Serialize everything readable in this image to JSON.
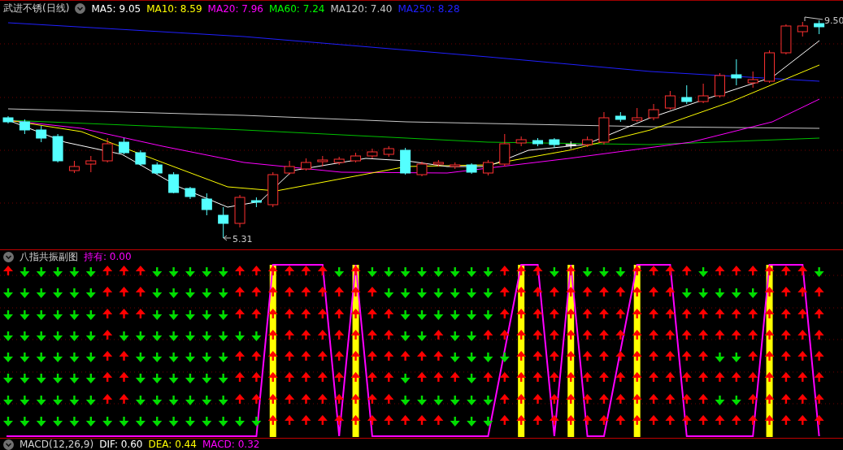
{
  "main_panel": {
    "title": "武进不锈(日线)",
    "indicators": [
      {
        "label": "MA5: 9.05",
        "color": "#ffffff"
      },
      {
        "label": "MA10: 8.59",
        "color": "#ffff00"
      },
      {
        "label": "MA20: 7.96",
        "color": "#ff00ff"
      },
      {
        "label": "MA60: 7.24",
        "color": "#00ff00"
      },
      {
        "label": "MA120: 7.40",
        "color": "#c8c8c8"
      },
      {
        "label": "MA250: 8.28",
        "color": "#2020ff"
      }
    ],
    "low_label": "5.31",
    "high_label": "9.50"
  },
  "signal_panel": {
    "title": "八指共振副图",
    "holding": "持有: 0.00",
    "marked": [
      false,
      false,
      false,
      false,
      false,
      false,
      false,
      false,
      false,
      false,
      false,
      false,
      false,
      false,
      false,
      false,
      true,
      false,
      false,
      false,
      false,
      true,
      false,
      false,
      false,
      false,
      false,
      false,
      false,
      false,
      false,
      true,
      false,
      false,
      true,
      false,
      false,
      false,
      true,
      false,
      false,
      false,
      false,
      false,
      false,
      false,
      true,
      false,
      false,
      false
    ],
    "signal_rows": [
      [
        true,
        false,
        false,
        false,
        false,
        false,
        true,
        true,
        true,
        false,
        false,
        false,
        false,
        false,
        true,
        true,
        true,
        true,
        true,
        true,
        false,
        true,
        false,
        false,
        false,
        false,
        false,
        false,
        false,
        false,
        true,
        true,
        true,
        false,
        true,
        false,
        false,
        false,
        true,
        true,
        true,
        true,
        false,
        true,
        true,
        true,
        true,
        true,
        true,
        false
      ],
      [
        false,
        false,
        false,
        false,
        false,
        false,
        true,
        true,
        true,
        false,
        false,
        false,
        false,
        false,
        true,
        true,
        true,
        true,
        true,
        true,
        true,
        true,
        true,
        false,
        false,
        false,
        false,
        false,
        false,
        false,
        true,
        true,
        true,
        true,
        true,
        true,
        true,
        true,
        true,
        true,
        true,
        false,
        false,
        false,
        false,
        false,
        true,
        true,
        true,
        true
      ],
      [
        false,
        false,
        false,
        false,
        false,
        false,
        true,
        true,
        true,
        false,
        false,
        false,
        false,
        false,
        true,
        true,
        true,
        true,
        true,
        true,
        true,
        true,
        true,
        true,
        false,
        false,
        false,
        false,
        false,
        false,
        true,
        true,
        true,
        true,
        true,
        true,
        true,
        true,
        true,
        true,
        true,
        true,
        true,
        true,
        true,
        true,
        true,
        true,
        true,
        true
      ],
      [
        false,
        false,
        false,
        false,
        false,
        false,
        true,
        false,
        false,
        false,
        false,
        false,
        false,
        false,
        false,
        false,
        true,
        true,
        true,
        true,
        true,
        true,
        true,
        true,
        false,
        false,
        true,
        false,
        false,
        true,
        true,
        true,
        true,
        true,
        true,
        true,
        true,
        true,
        true,
        true,
        true,
        true,
        true,
        true,
        true,
        true,
        true,
        true,
        true,
        true
      ],
      [
        false,
        false,
        false,
        false,
        false,
        false,
        true,
        true,
        false,
        false,
        false,
        false,
        false,
        false,
        true,
        true,
        true,
        true,
        true,
        true,
        true,
        true,
        true,
        true,
        true,
        true,
        true,
        false,
        false,
        false,
        false,
        true,
        true,
        true,
        true,
        true,
        true,
        true,
        true,
        true,
        true,
        true,
        true,
        false,
        false,
        true,
        true,
        true,
        true,
        true
      ],
      [
        false,
        false,
        false,
        false,
        false,
        false,
        true,
        true,
        false,
        false,
        false,
        false,
        false,
        false,
        true,
        true,
        true,
        true,
        true,
        true,
        true,
        true,
        true,
        true,
        false,
        true,
        true,
        true,
        false,
        true,
        true,
        true,
        true,
        true,
        true,
        true,
        true,
        true,
        true,
        true,
        true,
        true,
        true,
        true,
        true,
        true,
        true,
        true,
        true,
        true
      ],
      [
        false,
        false,
        false,
        false,
        false,
        false,
        true,
        true,
        false,
        false,
        false,
        false,
        false,
        false,
        true,
        true,
        true,
        true,
        true,
        true,
        true,
        true,
        true,
        true,
        false,
        false,
        false,
        false,
        false,
        false,
        true,
        true,
        true,
        true,
        true,
        true,
        true,
        true,
        true,
        true,
        true,
        true,
        true,
        false,
        false,
        true,
        true,
        true,
        true,
        true
      ],
      [
        false,
        false,
        false,
        false,
        false,
        false,
        false,
        false,
        false,
        false,
        false,
        false,
        false,
        false,
        false,
        false,
        true,
        true,
        true,
        true,
        true,
        true,
        true,
        true,
        true,
        true,
        true,
        false,
        false,
        false,
        true,
        true,
        true,
        true,
        true,
        true,
        true,
        true,
        true,
        true,
        true,
        true,
        true,
        true,
        true,
        true,
        true,
        true,
        true,
        true
      ]
    ]
  },
  "macd_panel": {
    "title": "MACD(12,26,9)",
    "values": [
      {
        "label": "DIF: 0.60",
        "color": "#ffffff"
      },
      {
        "label": "DEA: 0.44",
        "color": "#ffff00"
      },
      {
        "label": "MACD: 0.32",
        "color": "#ff00ff"
      }
    ]
  }
}
